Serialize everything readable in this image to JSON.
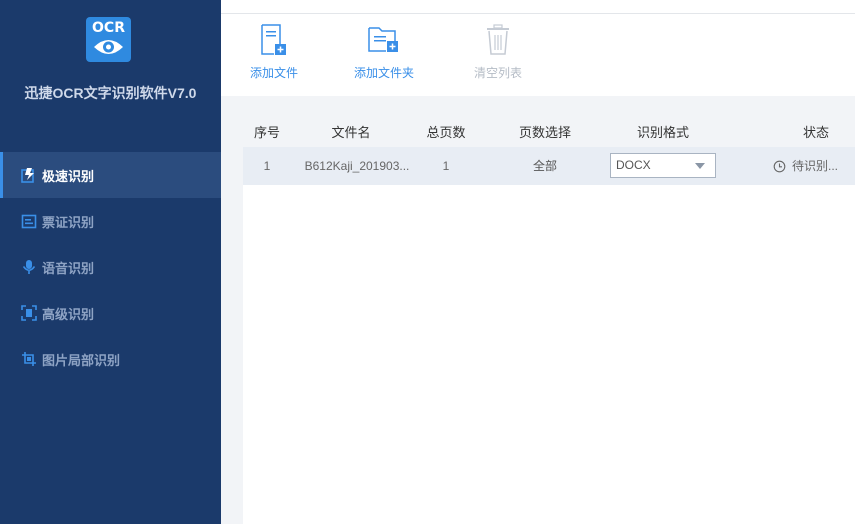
{
  "app": {
    "logo_text": "OCR",
    "title": "迅捷OCR文字识别软件V7.0"
  },
  "sidebar": {
    "items": [
      {
        "label": "极速识别",
        "icon": "fast-recognition-icon",
        "active": true
      },
      {
        "label": "票证识别",
        "icon": "ticket-icon",
        "active": false
      },
      {
        "label": "语音识别",
        "icon": "microphone-icon",
        "active": false
      },
      {
        "label": "高级识别",
        "icon": "scan-frame-icon",
        "active": false
      },
      {
        "label": "图片局部识别",
        "icon": "image-crop-icon",
        "active": false
      }
    ]
  },
  "toolbar": {
    "add_file": "添加文件",
    "add_folder": "添加文件夹",
    "clear_list": "清空列表"
  },
  "table": {
    "headers": {
      "index": "序号",
      "filename": "文件名",
      "total_pages": "总页数",
      "page_select": "页数选择",
      "format": "识别格式",
      "status": "状态"
    },
    "rows": [
      {
        "index": "1",
        "filename": "B612Kaji_201903...",
        "total_pages": "1",
        "page_select": "全部",
        "format": "DOCX",
        "status": "待识别..."
      }
    ]
  },
  "colors": {
    "sidebar_bg": "#1b3a6b",
    "active_bg": "#2b4c7e",
    "accent": "#3a8fe8"
  }
}
